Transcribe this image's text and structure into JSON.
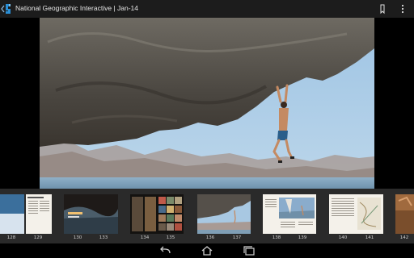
{
  "app": {
    "title": "National Geographic Interactive | Jan-14",
    "accent_color": "#2a8fd6",
    "bar_color": "#1c1c1c"
  },
  "icons": {
    "up": "chevron-left-icon",
    "logo": "ng-logo-icon",
    "bookmark": "bookmark-icon",
    "overflow": "overflow-menu-icon",
    "back": "back-icon",
    "home": "home-icon",
    "recents": "recents-icon"
  },
  "thumbnails": {
    "page_numbers": [
      "128",
      "129",
      "130",
      "133",
      "134",
      "135",
      "136",
      "137",
      "138",
      "139",
      "140",
      "141",
      "142"
    ]
  }
}
